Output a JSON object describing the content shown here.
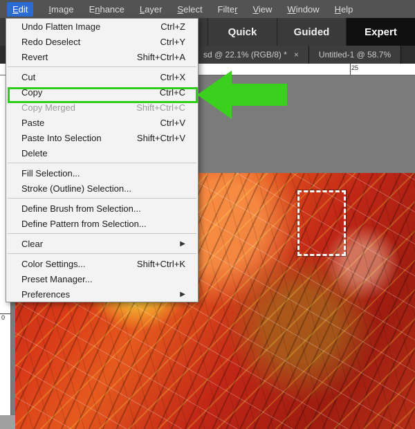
{
  "menubar": {
    "items": [
      {
        "key": "E",
        "rest": "dit"
      },
      {
        "key": "I",
        "rest": "mage"
      },
      {
        "key": "",
        "rest": "E",
        "key2": "n",
        "rest2": "hance"
      },
      {
        "key": "L",
        "rest": "ayer"
      },
      {
        "key": "S",
        "rest": "elect"
      },
      {
        "key": "",
        "rest": "Filte",
        "key2": "r",
        "rest2": ""
      },
      {
        "key": "V",
        "rest": "iew"
      },
      {
        "key": "W",
        "rest": "indow"
      },
      {
        "key": "H",
        "rest": "elp"
      }
    ]
  },
  "workspace_tabs": {
    "quick": "Quick",
    "guided": "Guided",
    "expert": "Expert"
  },
  "doc_tabs": {
    "tab1": "sd @ 22.1% (RGB/8) *",
    "tab2": "Untitled-1 @ 58.7%"
  },
  "ruler": {
    "h_25": "25",
    "v_0": "0"
  },
  "edit_menu": {
    "undo": {
      "label": "Undo Flatten Image",
      "accel": "Ctrl+Z"
    },
    "redo": {
      "label": "Redo Deselect",
      "accel": "Ctrl+Y"
    },
    "revert": {
      "label": "Revert",
      "accel": "Shift+Ctrl+A"
    },
    "cut": {
      "label": "Cut",
      "accel": "Ctrl+X"
    },
    "copy": {
      "label": "Copy",
      "accel": "Ctrl+C"
    },
    "copy_merged": {
      "label": "Copy Merged",
      "accel": "Shift+Ctrl+C"
    },
    "paste": {
      "label": "Paste",
      "accel": "Ctrl+V"
    },
    "paste_into": {
      "label": "Paste Into Selection",
      "accel": "Shift+Ctrl+V"
    },
    "delete": {
      "label": "Delete",
      "accel": ""
    },
    "fill": {
      "label": "Fill Selection...",
      "accel": ""
    },
    "stroke": {
      "label": "Stroke (Outline) Selection...",
      "accel": ""
    },
    "def_brush": {
      "label": "Define Brush from Selection...",
      "accel": ""
    },
    "def_pattern": {
      "label": "Define Pattern from Selection...",
      "accel": ""
    },
    "clear": {
      "label": "Clear",
      "accel": "▶"
    },
    "color": {
      "label": "Color Settings...",
      "accel": "Shift+Ctrl+K"
    },
    "preset": {
      "label": "Preset Manager...",
      "accel": ""
    },
    "prefs": {
      "label": "Preferences",
      "accel": "▶"
    }
  },
  "highlight_target": "copy"
}
